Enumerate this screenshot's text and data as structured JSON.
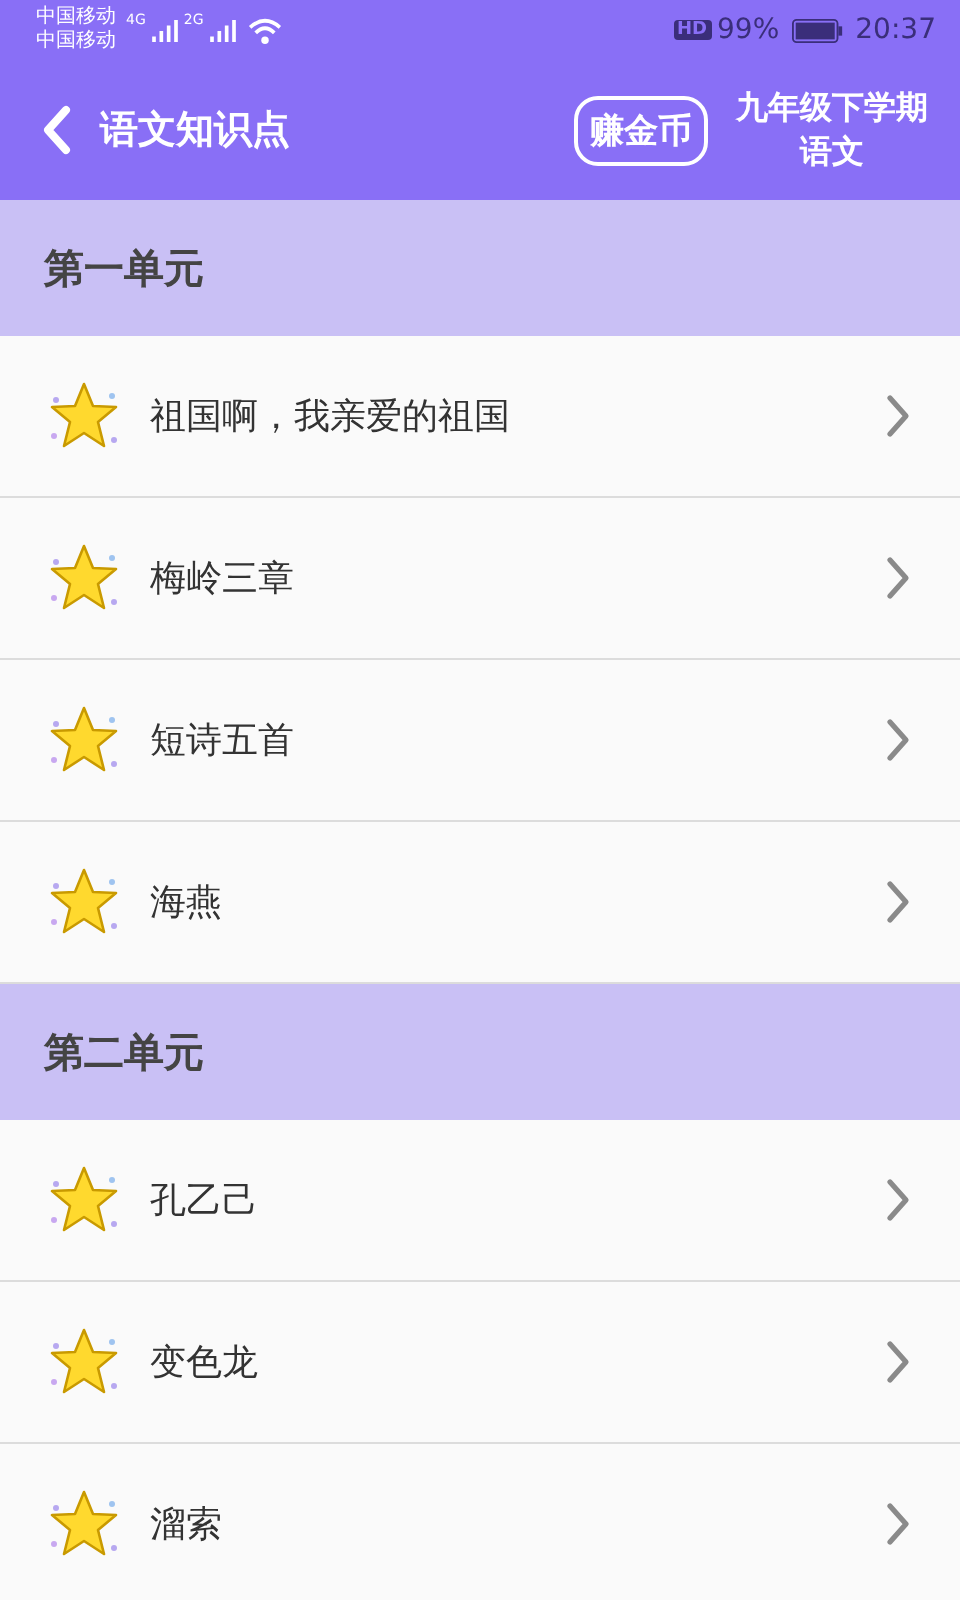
{
  "status_bar": {
    "carrier_1": "中国移动",
    "carrier_2": "中国移动",
    "network_1": "4G",
    "network_2": "2G",
    "hd": "HD",
    "battery": "99%",
    "time": "20:37"
  },
  "header": {
    "title": "语文知识点",
    "coin_button": "赚金币",
    "grade_line_1": "九年级下学期",
    "grade_line_2": "语文"
  },
  "units": [
    {
      "title": "第一单元",
      "lessons": [
        "祖国啊，我亲爱的祖国",
        "梅岭三章",
        "短诗五首",
        "海燕"
      ]
    },
    {
      "title": "第二单元",
      "lessons": [
        "孔乙己",
        "变色龙",
        "溜索"
      ]
    }
  ]
}
